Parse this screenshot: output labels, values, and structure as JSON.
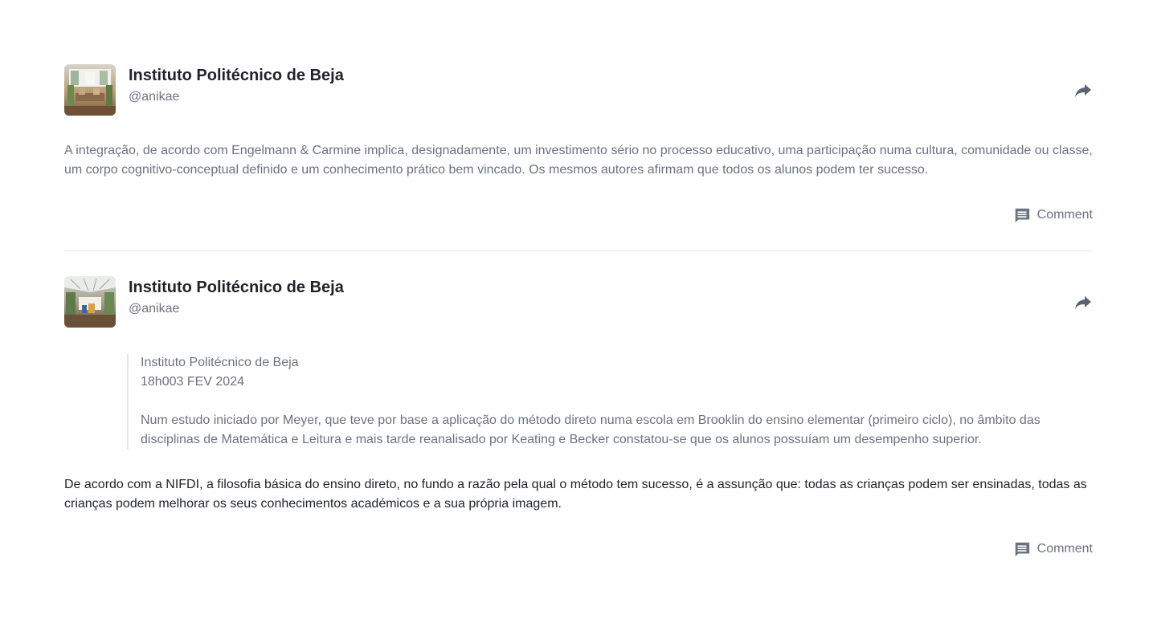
{
  "posts": [
    {
      "author": "Instituto Politécnico de Beja",
      "handle": "@anikae",
      "body": "A integração, de acordo com Engelmann & Carmine implica, designadamente, um investimento sério no processo educativo, uma participação numa cultura, comunidade ou classe, um corpo cognitivo-conceptual definido e um conhecimento prático bem vincado. Os mesmos autores afirmam que todos os alunos podem ter sucesso.",
      "comment_label": "Comment"
    },
    {
      "author": "Instituto Politécnico de Beja",
      "handle": "@anikae",
      "quote": {
        "author": "Instituto Politécnico de Beja",
        "date": "18h003 FEV 2024",
        "text": "Num estudo iniciado por Meyer, que teve por base a aplicação do método direto numa escola em Brooklin do ensino elementar (primeiro ciclo), no âmbito das disciplinas de Matemática e Leitura e mais tarde reanalisado por Keating e Becker constatou-se que os alunos possuíam um desempenho superior."
      },
      "body": "De acordo com a NIFDI, a filosofia básica do ensino direto, no fundo a razão pela qual o método tem sucesso, é a assunção que: todas as crianças podem ser ensinadas, todas as crianças podem melhorar os seus conhecimentos académicos e a sua própria imagem.",
      "comment_label": "Comment"
    }
  ],
  "icons": {
    "share": "share-icon",
    "comment": "comment-icon"
  },
  "colors": {
    "text_primary": "#1f2328",
    "text_muted": "#6b7280",
    "divider": "#e5e7eb"
  }
}
